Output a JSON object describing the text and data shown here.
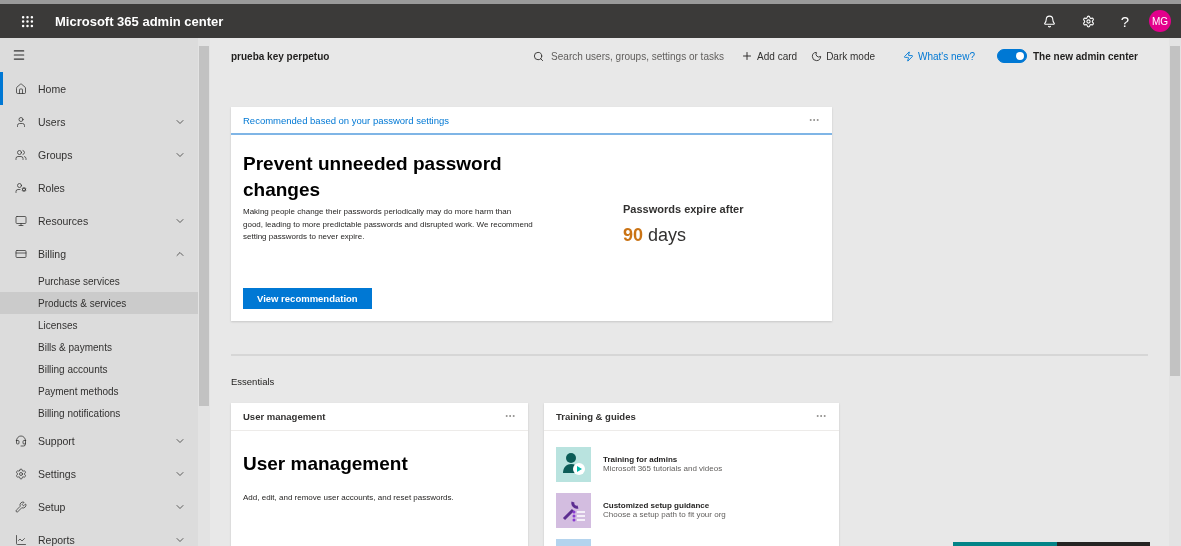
{
  "header": {
    "title": "Microsoft 365 admin center",
    "help": "?",
    "avatar": "MG"
  },
  "sidebar": {
    "items": [
      {
        "label": "Home",
        "kind": "link",
        "selected": true
      },
      {
        "label": "Users",
        "kind": "group",
        "selected": false,
        "expanded": false
      },
      {
        "label": "Groups",
        "kind": "group",
        "selected": false,
        "expanded": false
      },
      {
        "label": "Roles",
        "kind": "link",
        "selected": false
      },
      {
        "label": "Resources",
        "kind": "group",
        "selected": false,
        "expanded": false
      },
      {
        "label": "Billing",
        "kind": "group",
        "selected": false,
        "expanded": true,
        "children": [
          {
            "label": "Purchase services",
            "selected": false
          },
          {
            "label": "Products & services",
            "selected": true
          },
          {
            "label": "Licenses",
            "selected": false
          },
          {
            "label": "Bills & payments",
            "selected": false
          },
          {
            "label": "Billing accounts",
            "selected": false
          },
          {
            "label": "Payment methods",
            "selected": false
          },
          {
            "label": "Billing notifications",
            "selected": false
          }
        ]
      },
      {
        "label": "Support",
        "kind": "group",
        "selected": false,
        "expanded": false
      },
      {
        "label": "Settings",
        "kind": "group",
        "selected": false,
        "expanded": false
      },
      {
        "label": "Setup",
        "kind": "group",
        "selected": false,
        "expanded": false
      },
      {
        "label": "Reports",
        "kind": "group",
        "selected": false,
        "expanded": false
      }
    ]
  },
  "toolbar": {
    "org_name": "prueba key perpetuo",
    "search": {
      "placeholder": "Search users, groups, settings or tasks"
    },
    "add_card": "Add card",
    "dark_mode": "Dark mode",
    "whats_new": "What's new?",
    "new_admin_center": {
      "label": "The new admin center",
      "on": true
    }
  },
  "recommendation": {
    "label": "Recommended based on your password settings",
    "title": "Prevent unneeded password changes",
    "body": "Making people change their passwords periodically may do more harm than good, leading to more predictable passwords and disrupted work. We recommend setting passwords to never expire.",
    "button": "View recommendation",
    "stat_label": "Passwords expire after",
    "stat_value": "90",
    "stat_unit": "days"
  },
  "essentials": {
    "heading": "Essentials",
    "user_management": {
      "label": "User management",
      "title": "User management",
      "body": "Add, edit, and remove user accounts, and reset passwords."
    },
    "training": {
      "label": "Training & guides",
      "items": [
        {
          "title": "Training for admins",
          "subtitle": "Microsoft 365 tutorials and videos",
          "color": "#b9e3df"
        },
        {
          "title": "Customized setup guidance",
          "subtitle": "Choose a setup path to fit your org",
          "color": "#d3bde0"
        }
      ]
    }
  }
}
